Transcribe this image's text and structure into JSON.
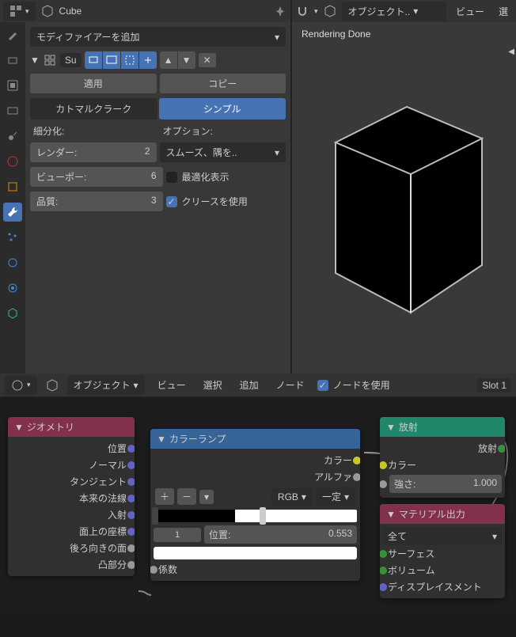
{
  "top": {
    "object": "Cube",
    "addMod": "モディファイアーを追加",
    "modShort": "Su",
    "apply": "適用",
    "copy": "コピー",
    "tab1": "カトマルクラーク",
    "tab2": "シンプル",
    "subdivide": "細分化:",
    "options": "オプション:",
    "render": "レンダー:",
    "renderVal": "2",
    "viewport": "ビューポー:",
    "viewportVal": "6",
    "quality": "品質:",
    "qualityVal": "3",
    "smooth": "スムーズ、隅を..",
    "optDisplay": "最適化表示",
    "useCrease": "クリースを使用"
  },
  "vp": {
    "mode": "オブジェクト..",
    "view": "ビュー",
    "select": "選",
    "status": "Rendering Done"
  },
  "ne": {
    "mode": "オブジェクト",
    "view": "ビュー",
    "select": "選択",
    "add": "追加",
    "node": "ノード",
    "useNodes": "ノードを使用",
    "slot": "Slot 1"
  },
  "geo": {
    "title": "ジオメトリ",
    "s": [
      "位置",
      "ノーマル",
      "タンジェント",
      "本来の法線",
      "入射",
      "面上の座標",
      "後ろ向きの面",
      "凸部分"
    ]
  },
  "ramp": {
    "title": "カラーランプ",
    "color": "カラー",
    "alpha": "アルファ",
    "rgb": "RGB",
    "const": "一定",
    "one": "1",
    "pos": "位置:",
    "posVal": "0.553",
    "factor": "係数"
  },
  "emit": {
    "title": "放射",
    "out": "放射",
    "color": "カラー",
    "strength": "強さ:",
    "strengthVal": "1.000"
  },
  "mat": {
    "title": "マテリアル出力",
    "all": "全て",
    "surface": "サーフェス",
    "volume": "ボリューム",
    "disp": "ディスプレイスメント"
  }
}
